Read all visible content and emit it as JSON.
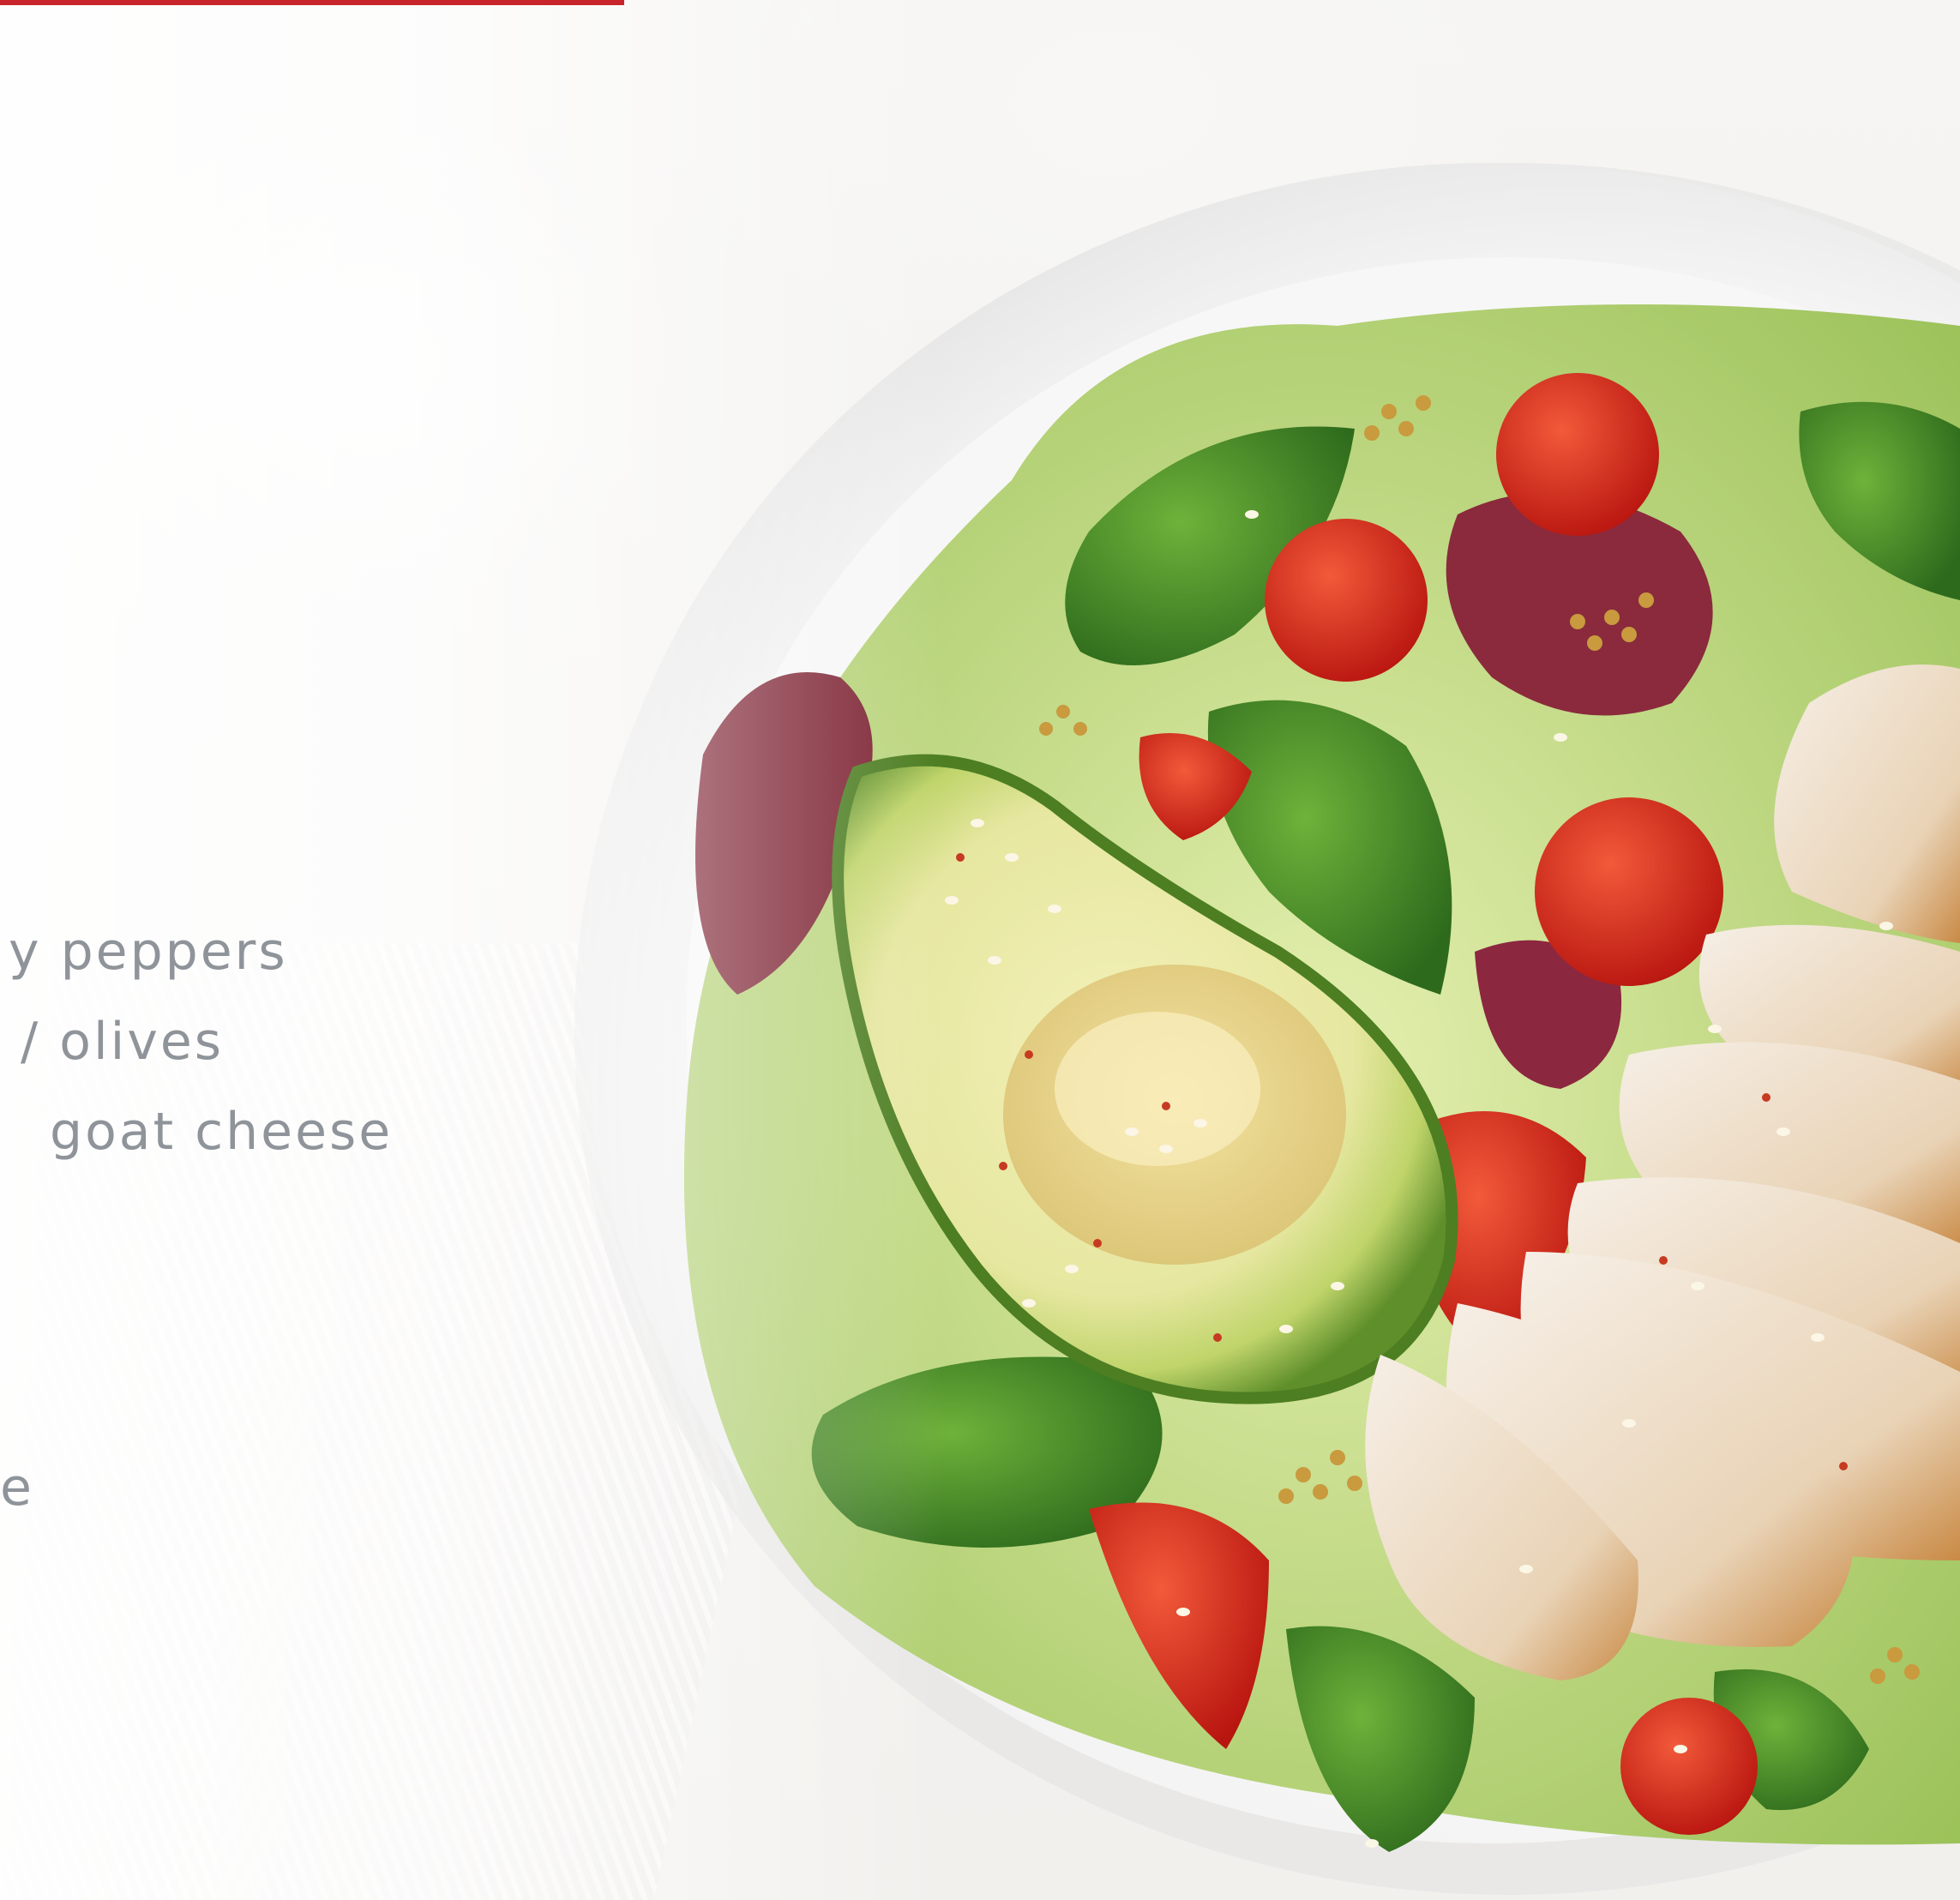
{
  "menu": {
    "lines": [
      "y peppers",
      "/  olives",
      "goat cheese",
      "e"
    ]
  },
  "colors": {
    "accent_bar": "#c8242b",
    "text": "#8f949a"
  }
}
